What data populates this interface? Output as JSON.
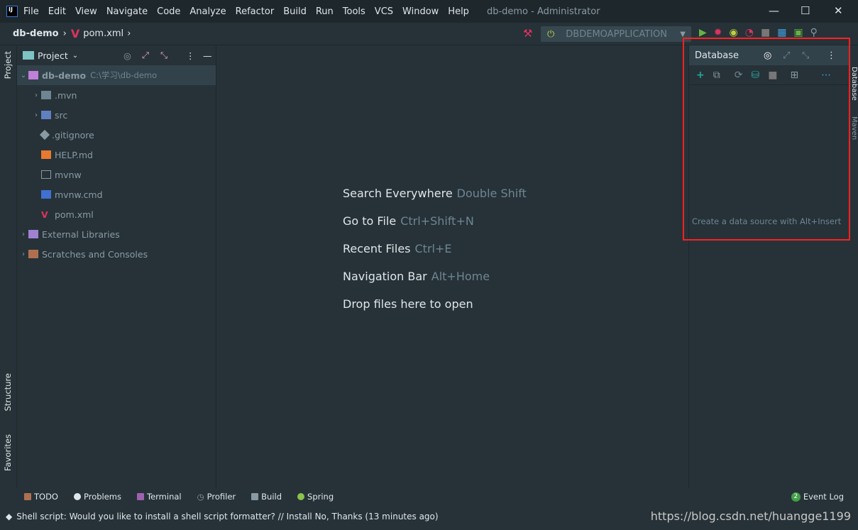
{
  "window": {
    "title": "db-demo - Administrator",
    "logo": "IJ"
  },
  "menu": [
    "File",
    "Edit",
    "View",
    "Navigate",
    "Code",
    "Analyze",
    "Refactor",
    "Build",
    "Run",
    "Tools",
    "VCS",
    "Window",
    "Help"
  ],
  "breadcrumb": {
    "project": "db-demo",
    "file": "pom.xml"
  },
  "run_config": {
    "label": "DBDEMOAPPLICATION"
  },
  "left_tabs": {
    "project": "Project",
    "structure": "Structure",
    "favorites": "Favorites"
  },
  "project_panel": {
    "title": "Project",
    "root": {
      "name": "db-demo",
      "path": "C:\\学习\\db-demo"
    },
    "items": [
      {
        "name": ".mvn",
        "icon": "folder-icon",
        "expandable": true
      },
      {
        "name": "src",
        "icon": "source-folder-icon",
        "expandable": true
      },
      {
        "name": ".gitignore",
        "icon": "git-icon",
        "expandable": false
      },
      {
        "name": "HELP.md",
        "icon": "markdown-icon",
        "expandable": false
      },
      {
        "name": "mvnw",
        "icon": "text-file-icon",
        "expandable": false
      },
      {
        "name": "mvnw.cmd",
        "icon": "cmd-icon",
        "expandable": false
      },
      {
        "name": "pom.xml",
        "icon": "maven-icon",
        "expandable": false
      }
    ],
    "extra": [
      {
        "name": "External Libraries",
        "icon": "library-icon"
      },
      {
        "name": "Scratches and Consoles",
        "icon": "scratches-icon"
      }
    ]
  },
  "editor_hints": [
    {
      "action": "Search Everywhere",
      "key": "Double Shift"
    },
    {
      "action": "Go to File",
      "key": "Ctrl+Shift+N"
    },
    {
      "action": "Recent Files",
      "key": "Ctrl+E"
    },
    {
      "action": "Navigation Bar",
      "key": "Alt+Home"
    },
    {
      "action": "Drop files here to open",
      "key": ""
    }
  ],
  "database_panel": {
    "title": "Database",
    "empty_text": "Create a data source with Alt+Insert"
  },
  "right_tabs": {
    "database": "Database",
    "maven": "Maven"
  },
  "bottom_tools": [
    "TODO",
    "Problems",
    "Terminal",
    "Profiler",
    "Build",
    "Spring"
  ],
  "event_log": {
    "label": "Event Log",
    "count": "2"
  },
  "status": {
    "message": "Shell script: Would you like to install a shell script formatter? // Install   No, Thanks (13 minutes ago)"
  },
  "watermark": "https://blog.csdn.net/huangge1199",
  "colors": {
    "accent_red": "#ff2020",
    "bg": "#263238"
  }
}
